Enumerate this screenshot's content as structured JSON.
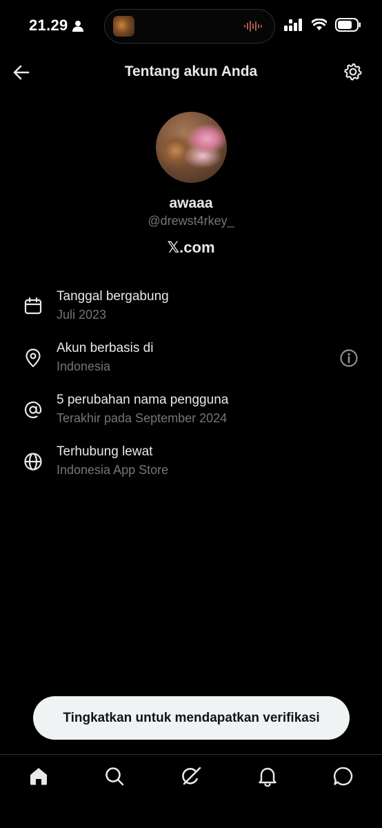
{
  "status_bar": {
    "time": "21.29"
  },
  "header": {
    "title": "Tentang akun Anda"
  },
  "profile": {
    "display_name": "awaaa",
    "handle": "@drewst4rkey_",
    "site": "𝕏.com"
  },
  "info": [
    {
      "icon": "calendar-icon",
      "label": "Tanggal bergabung",
      "value": "Juli 2023"
    },
    {
      "icon": "location-pin-icon",
      "label": "Akun berbasis di",
      "value": "Indonesia"
    },
    {
      "icon": "at-sign-icon",
      "label": "5 perubahan nama pengguna",
      "value": "Terakhir pada September 2024"
    },
    {
      "icon": "globe-icon",
      "label": "Terhubung lewat",
      "value": "Indonesia App Store"
    }
  ],
  "upgrade_button": {
    "label": "Tingkatkan untuk mendapatkan verifikasi"
  },
  "nav": [
    "home-icon",
    "search-icon",
    "grok-icon",
    "notifications-icon",
    "messages-icon"
  ],
  "colors": {
    "background": "#000000",
    "primary_text": "#e7e9ea",
    "secondary_text": "#71767b",
    "button_bg": "#eff3f4"
  }
}
